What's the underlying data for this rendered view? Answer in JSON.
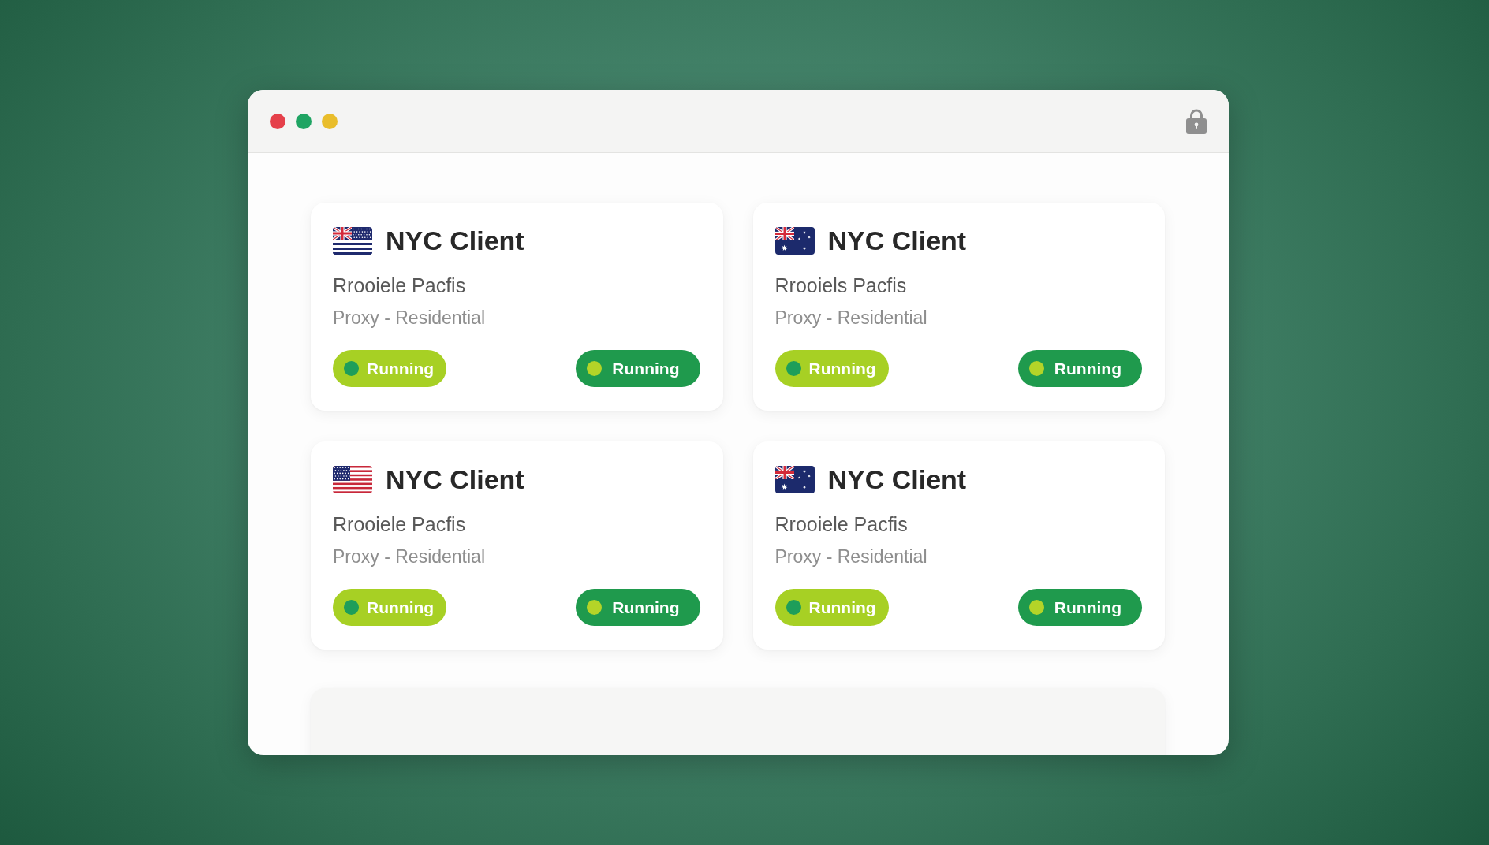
{
  "window": {
    "controls": [
      {
        "color": "#e5404a"
      },
      {
        "color": "#1fa463"
      },
      {
        "color": "#e9bd2b"
      }
    ]
  },
  "cards": [
    {
      "flag": {
        "kind": "mixed"
      },
      "title": "NYC Client",
      "subtitle": "Rrooiele Pacfis",
      "detail": "Proxy - Residential",
      "statuses": [
        {
          "label": "Running",
          "kind": "light"
        },
        {
          "label": "Running",
          "kind": "dark"
        }
      ]
    },
    {
      "flag": {
        "kind": "au"
      },
      "title": "NYC Client",
      "subtitle": "Rrooiels Pacfis",
      "detail": "Proxy - Residential",
      "statuses": [
        {
          "label": "Running",
          "kind": "light"
        },
        {
          "label": "Running",
          "kind": "dark"
        }
      ]
    },
    {
      "flag": {
        "kind": "us"
      },
      "title": "NYC Client",
      "subtitle": "Rrooiele Pacfis",
      "detail": "Proxy - Residential",
      "statuses": [
        {
          "label": "Running",
          "kind": "light"
        },
        {
          "label": "Running",
          "kind": "dark"
        }
      ]
    },
    {
      "flag": {
        "kind": "au"
      },
      "title": "NYC Client",
      "subtitle": "Rrooiele Pacfis",
      "detail": "Proxy - Residential",
      "statuses": [
        {
          "label": "Running",
          "kind": "light"
        },
        {
          "label": "Running",
          "kind": "dark"
        }
      ]
    }
  ]
}
